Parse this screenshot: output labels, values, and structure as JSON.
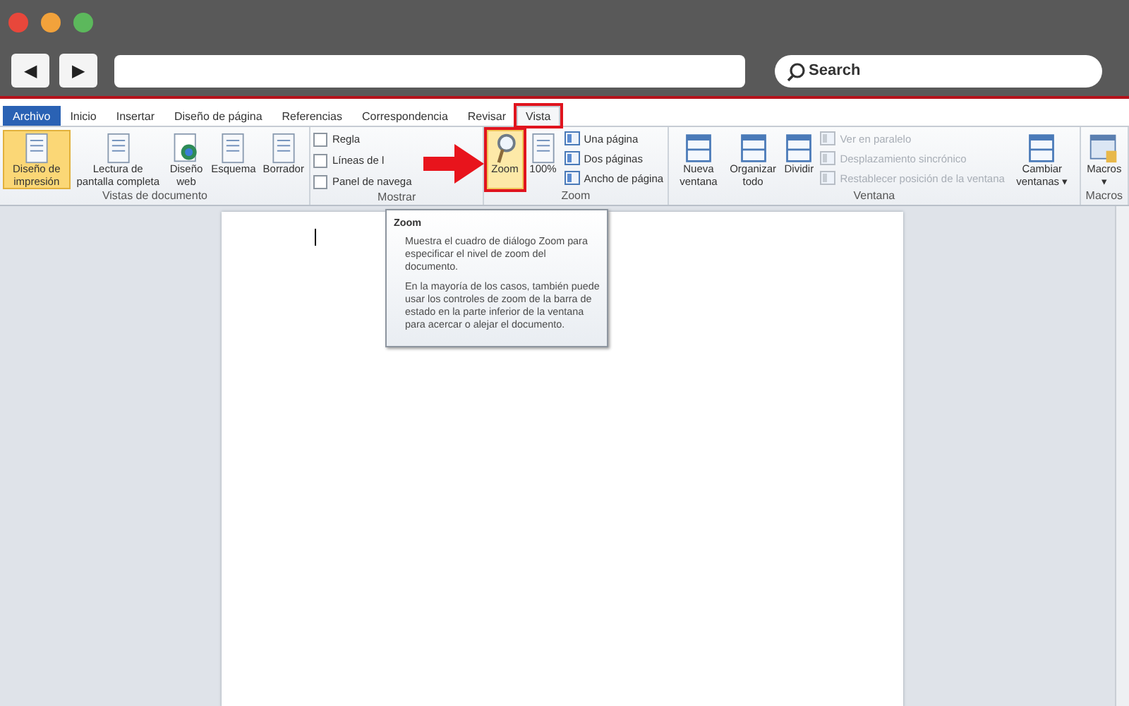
{
  "browser": {
    "back": "◀",
    "forward": "▶",
    "search": {
      "placeholder": "Search"
    }
  },
  "ribbon": {
    "tabs": [
      {
        "label": "Archivo",
        "kind": "file",
        "selected": false,
        "highlighted": false
      },
      {
        "label": "Inicio",
        "kind": "tab",
        "selected": false,
        "highlighted": false
      },
      {
        "label": "Insertar",
        "kind": "tab",
        "selected": false,
        "highlighted": false
      },
      {
        "label": "Diseño de página",
        "kind": "tab",
        "selected": false,
        "highlighted": false
      },
      {
        "label": "Referencias",
        "kind": "tab",
        "selected": false,
        "highlighted": false
      },
      {
        "label": "Correspondencia",
        "kind": "tab",
        "selected": false,
        "highlighted": false
      },
      {
        "label": "Revisar",
        "kind": "tab",
        "selected": false,
        "highlighted": false
      },
      {
        "label": "Vista",
        "kind": "tab",
        "selected": true,
        "highlighted": true
      }
    ],
    "groups": [
      {
        "label": "Vistas de documento",
        "items": [
          {
            "kind": "large",
            "label": "Diseño de impresión",
            "selected": true
          },
          {
            "kind": "large",
            "label": "Lectura de pantalla completa",
            "selected": false
          },
          {
            "kind": "large",
            "label": "Diseño web",
            "selected": false
          },
          {
            "kind": "large",
            "label": "Esquema",
            "selected": false
          },
          {
            "kind": "large",
            "label": "Borrador",
            "selected": false
          }
        ]
      },
      {
        "label": "Mostrar",
        "items": [
          {
            "kind": "check",
            "label": "Regla",
            "checked": false
          },
          {
            "kind": "check",
            "label": "Líneas de l",
            "checked": false
          },
          {
            "kind": "check",
            "label": "Panel de navega",
            "checked": false
          }
        ]
      },
      {
        "label": "Zoom",
        "items": [
          {
            "kind": "large",
            "label": "Zoom",
            "selected": false,
            "hover": true,
            "highlighted": true
          },
          {
            "kind": "large",
            "label": "100%",
            "selected": false
          },
          {
            "kind": "small",
            "label": "Una página",
            "disabled": false
          },
          {
            "kind": "small",
            "label": "Dos páginas",
            "disabled": false
          },
          {
            "kind": "small",
            "label": "Ancho de página",
            "disabled": false
          }
        ]
      },
      {
        "label": "Ventana",
        "items": [
          {
            "kind": "large",
            "label": "Nueva ventana",
            "selected": false
          },
          {
            "kind": "large",
            "label": "Organizar todo",
            "selected": false
          },
          {
            "kind": "large",
            "label": "Dividir",
            "selected": false
          },
          {
            "kind": "small",
            "label": "Ver en paralelo",
            "disabled": true
          },
          {
            "kind": "small",
            "label": "Desplazamiento sincrónico",
            "disabled": true
          },
          {
            "kind": "small",
            "label": "Restablecer posición de la ventana",
            "disabled": true
          },
          {
            "kind": "large",
            "label": "Cambiar ventanas ▾",
            "selected": false
          }
        ]
      },
      {
        "label": "Macros",
        "items": [
          {
            "kind": "large",
            "label": "Macros ▾",
            "selected": false
          }
        ]
      }
    ]
  },
  "tooltip": {
    "title": "Zoom",
    "paragraphs": [
      "Muestra el cuadro de diálogo Zoom para especificar el nivel de zoom del documento.",
      "En la mayoría de los casos, también puede usar los controles de zoom de la barra de estado en la parte inferior de la ventana para acercar o alejar el documento."
    ]
  }
}
